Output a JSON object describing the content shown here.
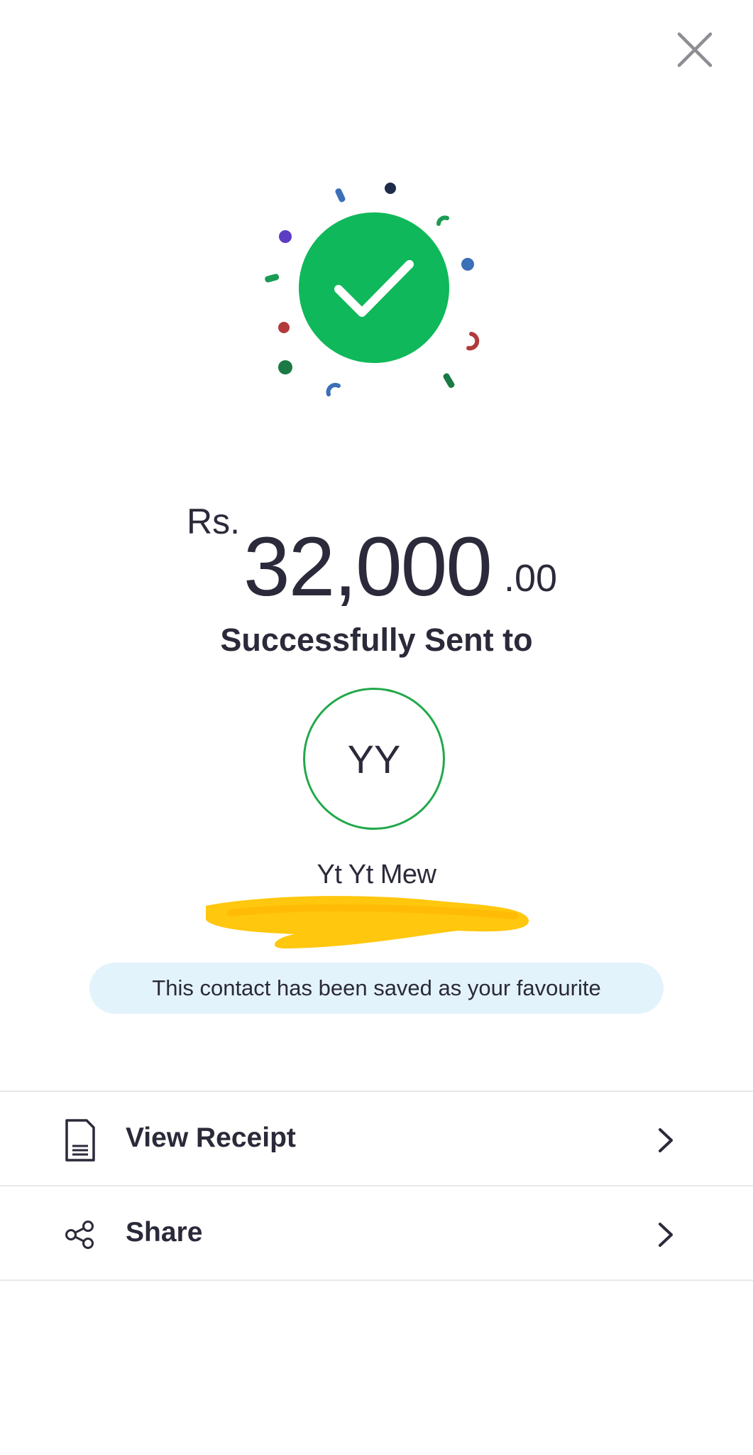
{
  "header": {
    "close_icon": "close-icon"
  },
  "illustration": {
    "icon": "checkmark-icon",
    "accent_color": "#0fb85a"
  },
  "amount": {
    "currency": "Rs.",
    "whole": "32,000",
    "decimals": ".00"
  },
  "status": {
    "text": "Successfully Sent to"
  },
  "recipient": {
    "initials": "YY",
    "name": "Yt Yt Mew",
    "avatar_border_color": "#21a84a"
  },
  "favourite_banner": {
    "text": "This contact has been saved as your favourite"
  },
  "actions": [
    {
      "label": "View Receipt",
      "icon": "receipt-icon"
    },
    {
      "label": "Share",
      "icon": "share-icon"
    }
  ]
}
